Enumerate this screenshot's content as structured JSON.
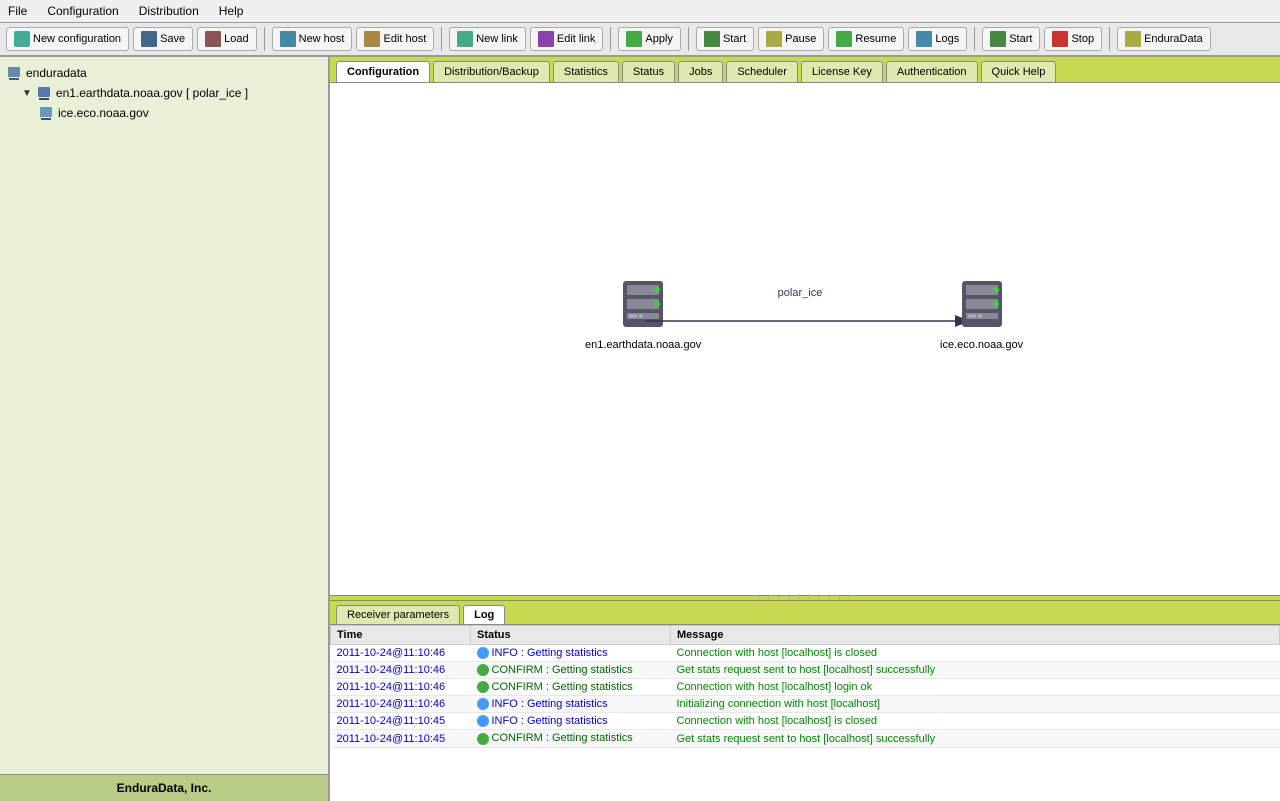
{
  "menu": {
    "items": [
      "File",
      "Configuration",
      "Distribution",
      "Help"
    ]
  },
  "toolbar": {
    "buttons": [
      {
        "id": "new-config",
        "label": "New configuration",
        "icon": "new-config-icon"
      },
      {
        "id": "save",
        "label": "Save",
        "icon": "save-icon"
      },
      {
        "id": "load",
        "label": "Load",
        "icon": "load-icon"
      },
      {
        "id": "new-host",
        "label": "New host",
        "icon": "new-host-icon"
      },
      {
        "id": "edit-host",
        "label": "Edit host",
        "icon": "edit-host-icon"
      },
      {
        "id": "new-link",
        "label": "New link",
        "icon": "new-link-icon"
      },
      {
        "id": "edit-link",
        "label": "Edit link",
        "icon": "edit-link-icon"
      },
      {
        "id": "apply",
        "label": "Apply",
        "icon": "apply-icon"
      },
      {
        "id": "start",
        "label": "Start",
        "icon": "start-icon"
      },
      {
        "id": "pause",
        "label": "Pause",
        "icon": "pause-icon"
      },
      {
        "id": "resume",
        "label": "Resume",
        "icon": "resume-icon"
      },
      {
        "id": "logs",
        "label": "Logs",
        "icon": "logs-icon"
      },
      {
        "id": "start2",
        "label": "Start",
        "icon": "start2-icon"
      },
      {
        "id": "stop",
        "label": "Stop",
        "icon": "stop-icon"
      },
      {
        "id": "enduradata",
        "label": "EnduraData",
        "icon": "enduradata-icon"
      }
    ]
  },
  "sidebar": {
    "root": {
      "label": "enduradata",
      "icon": "server-icon",
      "children": [
        {
          "label": "en1.earthdata.noaa.gov [ polar_ice ]",
          "icon": "server-icon",
          "children": [
            {
              "label": "ice.eco.noaa.gov",
              "icon": "server-icon"
            }
          ]
        }
      ]
    },
    "footer": "EnduraData, Inc."
  },
  "tabs": {
    "items": [
      "Configuration",
      "Distribution/Backup",
      "Statistics",
      "Status",
      "Jobs",
      "Scheduler",
      "License Key",
      "Authentication",
      "Quick Help"
    ],
    "active": "Statistics"
  },
  "diagram": {
    "source": {
      "label": "en1.earthdata.noaa.gov"
    },
    "link_label": "polar_ice",
    "target": {
      "label": "ice.eco.noaa.gov"
    }
  },
  "bottom_tabs": {
    "items": [
      "Receiver parameters",
      "Log"
    ],
    "active": "Log"
  },
  "log_table": {
    "headers": [
      "Time",
      "Status",
      "Message"
    ],
    "rows": [
      {
        "time": "2011-10-24@11:10:46",
        "status_type": "info",
        "status": "INFO : Getting statistics",
        "message": "Connection with host [localhost] is closed"
      },
      {
        "time": "2011-10-24@11:10:46",
        "status_type": "confirm",
        "status": "CONFIRM : Getting statistics",
        "message": "Get stats request sent to host [localhost] successfully"
      },
      {
        "time": "2011-10-24@11:10:46",
        "status_type": "confirm",
        "status": "CONFIRM : Getting statistics",
        "message": "Connection with host [localhost] login ok"
      },
      {
        "time": "2011-10-24@11:10:46",
        "status_type": "info",
        "status": "INFO : Getting statistics",
        "message": "Initializing connection with host [localhost]"
      },
      {
        "time": "2011-10-24@11:10:45",
        "status_type": "info",
        "status": "INFO : Getting statistics",
        "message": "Connection with host [localhost] is closed"
      },
      {
        "time": "2011-10-24@11:10:45",
        "status_type": "confirm",
        "status": "CONFIRM : Getting statistics",
        "message": "Get stats request sent to host [localhost] successfully"
      }
    ]
  }
}
